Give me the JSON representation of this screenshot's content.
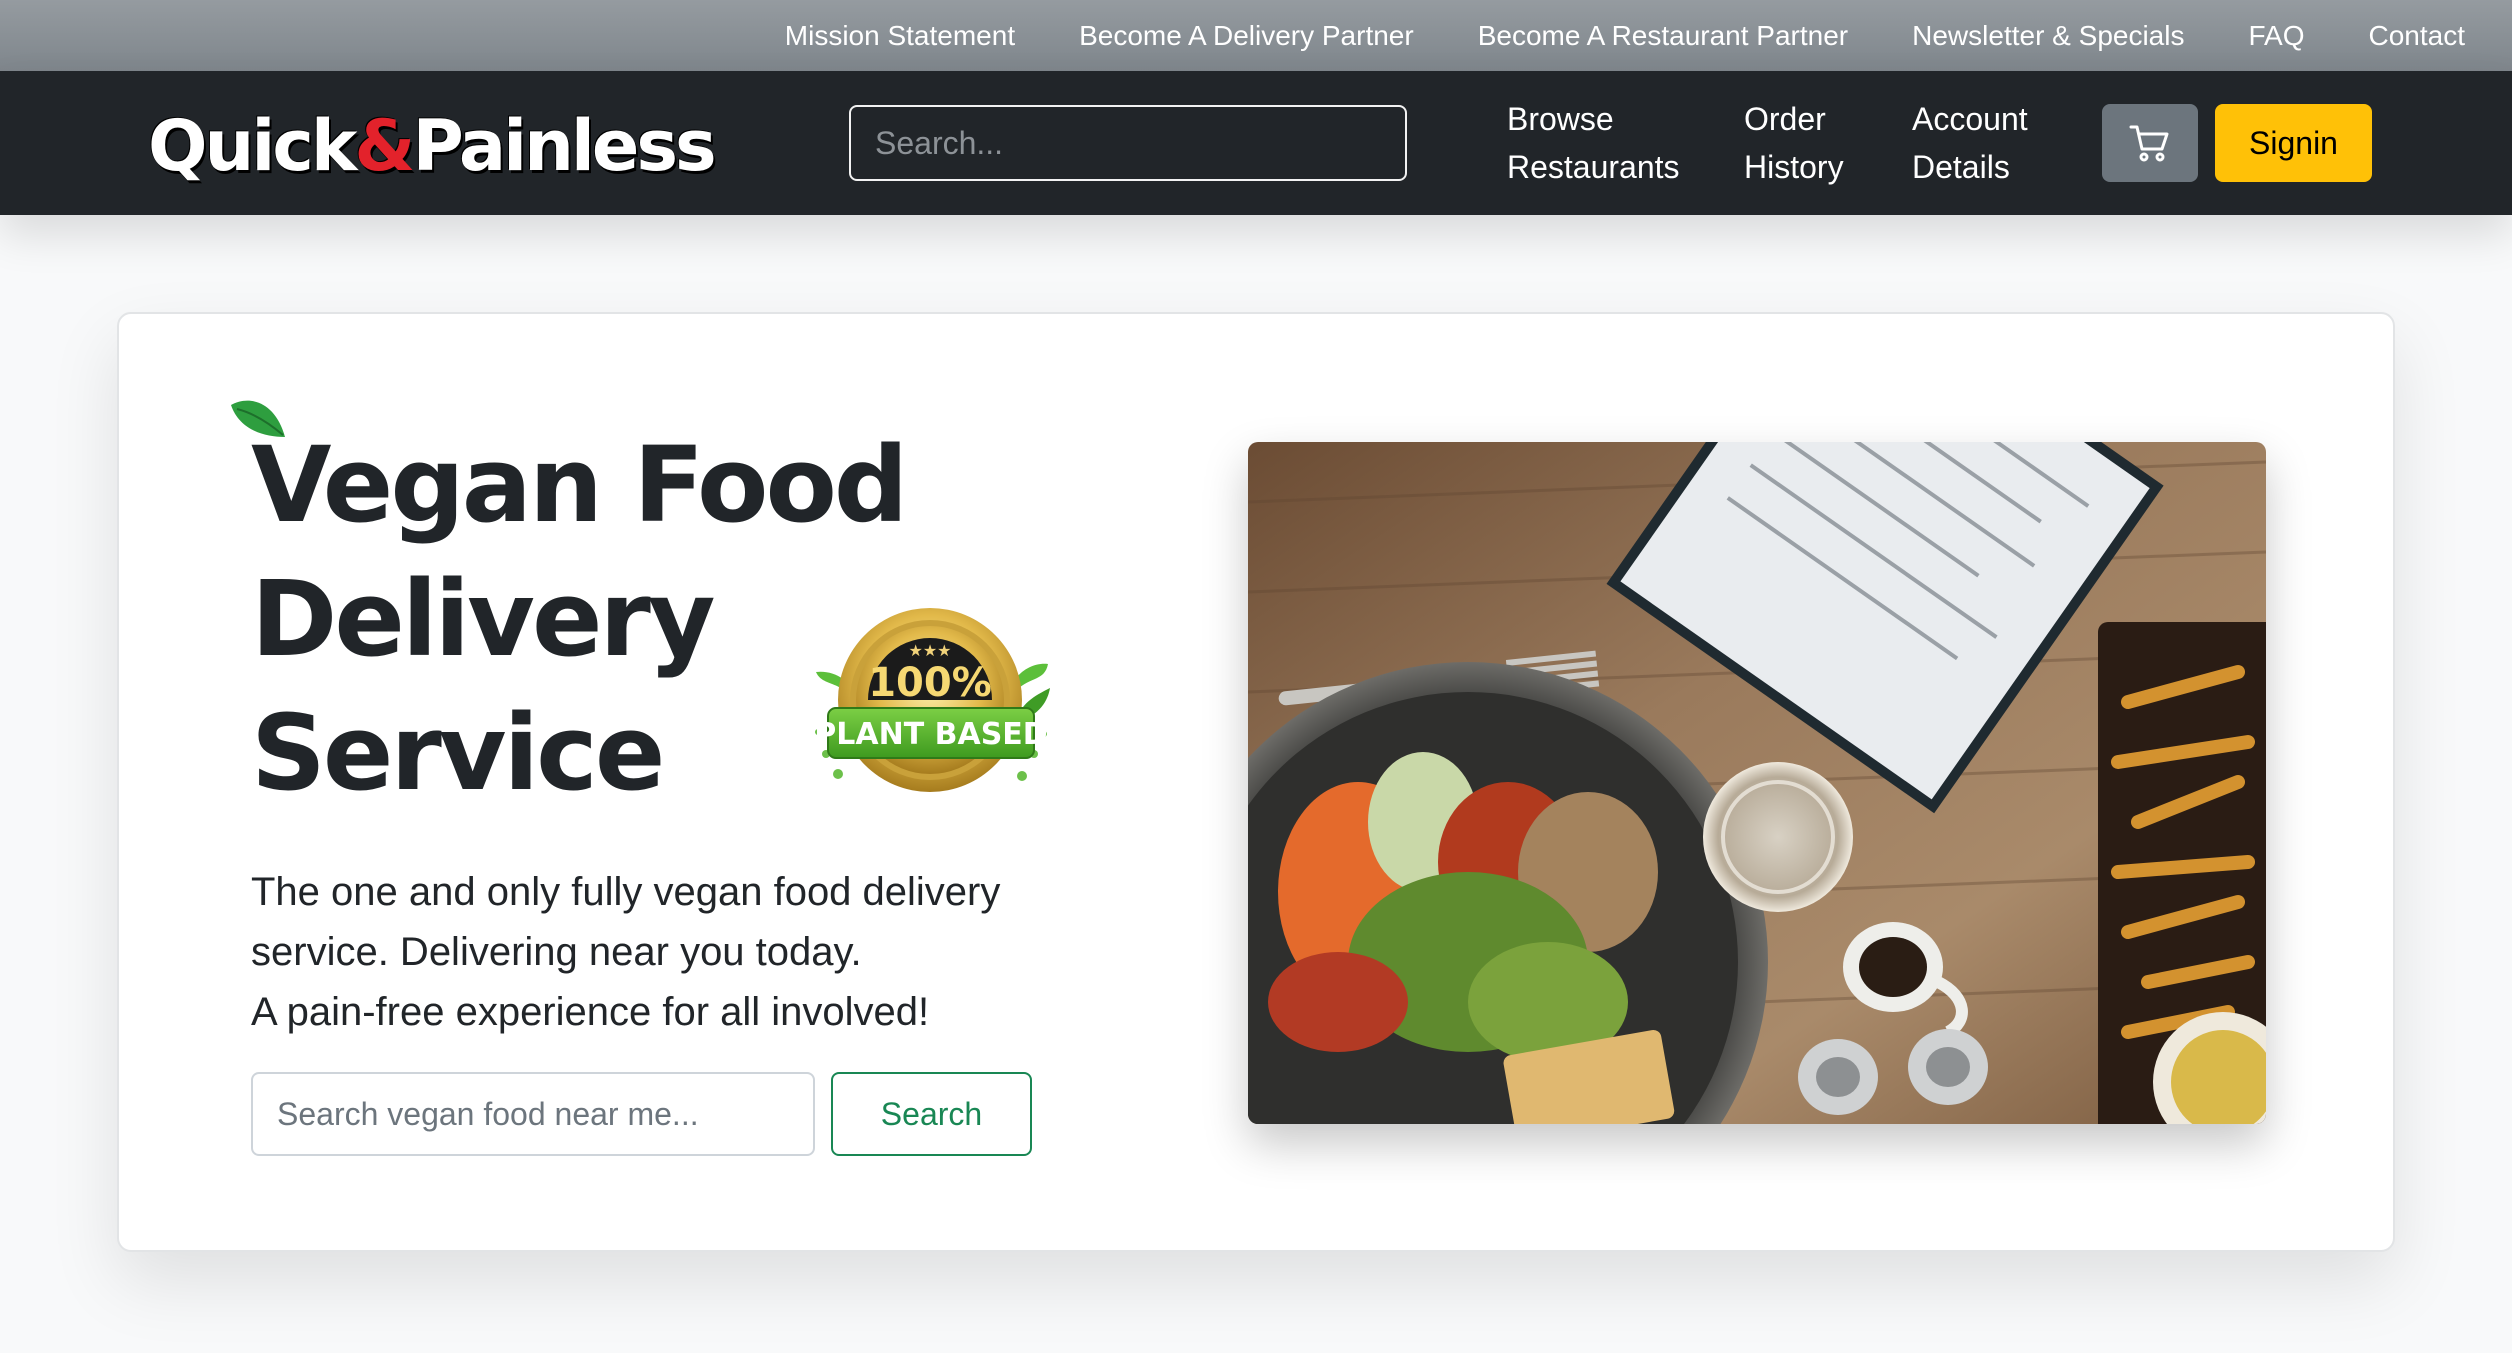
{
  "topbar": {
    "links": [
      "Mission Statement",
      "Become A Delivery Partner",
      "Become A Restaurant Partner",
      "Newsletter & Specials",
      "FAQ",
      "Contact"
    ]
  },
  "navbar": {
    "brand": {
      "part1": "Quick",
      "amp": "&",
      "part2": "Painless"
    },
    "search_placeholder": "Search...",
    "links": [
      {
        "line1": "Browse",
        "line2": "Restaurants"
      },
      {
        "line1": "Order",
        "line2": "History"
      },
      {
        "line1": "Account",
        "line2": "Details"
      }
    ],
    "cart_icon": "cart-icon",
    "signin_label": "Signin"
  },
  "hero": {
    "title_lines": [
      "Vegan Food",
      "Delivery",
      "Service"
    ],
    "badge": {
      "stars": "★★★",
      "percent": "100%",
      "label": "PLANT BASED"
    },
    "description_lines": [
      "The one and only fully vegan food delivery",
      "service. Delivering near you today.",
      "A pain-free experience for all involved!"
    ],
    "search_placeholder": "Search vegan food near me...",
    "search_button": "Search"
  },
  "colors": {
    "navbar_bg": "#212529",
    "signin_bg": "#ffc107",
    "accent_red": "#e3222b",
    "success_green": "#198754"
  }
}
